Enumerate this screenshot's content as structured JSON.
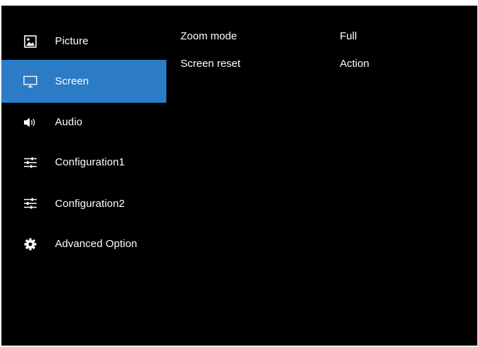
{
  "menu": {
    "items": [
      {
        "label": "Picture",
        "icon": "picture-icon"
      },
      {
        "label": "Screen",
        "icon": "monitor-icon",
        "active": true
      },
      {
        "label": "Audio",
        "icon": "speaker-icon"
      },
      {
        "label": "Configuration1",
        "icon": "sliders-icon"
      },
      {
        "label": "Configuration2",
        "icon": "sliders-icon"
      },
      {
        "label": "Advanced Option",
        "icon": "gear-icon"
      }
    ]
  },
  "settings": {
    "rows": [
      {
        "name": "Zoom mode",
        "value": "Full"
      },
      {
        "name": "Screen reset",
        "value": "Action"
      }
    ]
  },
  "colors": {
    "background": "#000000",
    "highlight": "#2b7bc6",
    "text": "#ffffff"
  }
}
